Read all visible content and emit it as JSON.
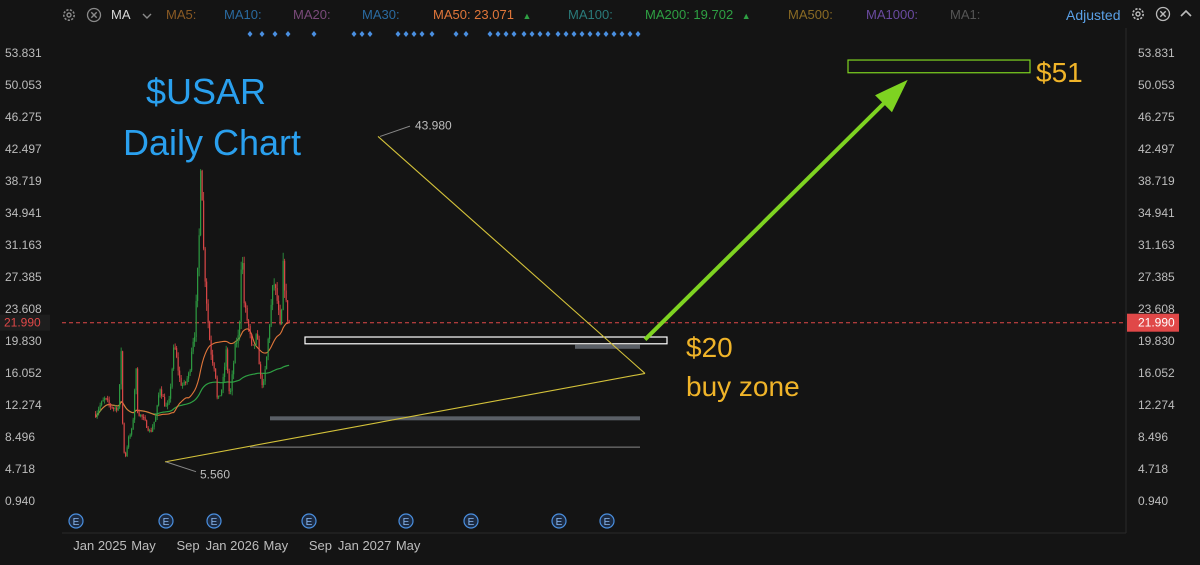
{
  "toolbar": {
    "indicator_select": "MA",
    "adjusted_label": "Adjusted",
    "ma_items": [
      {
        "label": "MA5:",
        "value": "",
        "color": "#8a5a24"
      },
      {
        "label": "MA10:",
        "value": "",
        "color": "#2a6aa0"
      },
      {
        "label": "MA20:",
        "value": "",
        "color": "#7a4a7a"
      },
      {
        "label": "MA30:",
        "value": "",
        "color": "#2a6aa0"
      },
      {
        "label": "MA50:",
        "value": "23.071",
        "color": "#e0763a",
        "arrow": "▲"
      },
      {
        "label": "MA100:",
        "value": "",
        "color": "#2a7a7a"
      },
      {
        "label": "MA200:",
        "value": "19.702",
        "color": "#2ea043",
        "arrow": "▲"
      },
      {
        "label": "MA500:",
        "value": "",
        "color": "#8a6a24"
      },
      {
        "label": "MA1000:",
        "value": "",
        "color": "#6a4aa0"
      },
      {
        "label": "MA1:",
        "value": "",
        "color": "#555555"
      }
    ]
  },
  "colors": {
    "up": "#2ea043",
    "down": "#e04848",
    "ma50": "#e0763a",
    "ma200": "#2ea043",
    "trendline": "#d4c23a",
    "annotation_blue": "#2aa0ee",
    "annotation_yellow": "#f0b429",
    "arrow_green": "#7ed321",
    "last_price": "#e04848"
  },
  "chart_data": {
    "type": "candlestick",
    "title": "$USAR",
    "subtitle": "Daily Chart",
    "y_ticks": [
      "53.831",
      "50.053",
      "46.275",
      "42.497",
      "38.719",
      "34.941",
      "31.163",
      "27.385",
      "23.608",
      "19.830",
      "16.052",
      "12.274",
      "8.496",
      "4.718",
      "0.940"
    ],
    "ylim": [
      0.94,
      53.831
    ],
    "x_ticks": [
      "Jan 2025",
      "May",
      "Sep",
      "Jan 2026",
      "May",
      "Sep",
      "Jan 2027",
      "May"
    ],
    "last_price": "21.990",
    "price_path": [
      [
        "2024-12-20",
        11.2
      ],
      [
        "2025-01-01",
        12.2
      ],
      [
        "2025-01-15",
        13.0
      ],
      [
        "2025-01-28",
        12.2
      ],
      [
        "2025-02-10",
        11.9
      ],
      [
        "2025-02-22",
        12.0
      ],
      [
        "2025-03-01",
        19.5
      ],
      [
        "2025-03-04",
        10.5
      ],
      [
        "2025-03-10",
        5.6
      ],
      [
        "2025-03-20",
        8.2
      ],
      [
        "2025-04-01",
        9.5
      ],
      [
        "2025-04-10",
        17.0
      ],
      [
        "2025-04-15",
        11.5
      ],
      [
        "2025-05-01",
        10.6
      ],
      [
        "2025-05-20",
        9.0
      ],
      [
        "2025-06-05",
        11.0
      ],
      [
        "2025-06-15",
        14.5
      ],
      [
        "2025-07-01",
        12.0
      ],
      [
        "2025-07-10",
        12.3
      ],
      [
        "2025-07-25",
        19.5
      ],
      [
        "2025-08-10",
        15.0
      ],
      [
        "2025-08-20",
        14.5
      ],
      [
        "2025-09-05",
        16.0
      ],
      [
        "2025-09-12",
        19.5
      ],
      [
        "2025-09-20",
        21.0
      ],
      [
        "2025-10-01",
        31.0
      ],
      [
        "2025-10-07",
        43.98
      ],
      [
        "2025-10-12",
        32.0
      ],
      [
        "2025-10-20",
        26.0
      ],
      [
        "2025-10-28",
        21.0
      ],
      [
        "2025-11-05",
        18.0
      ],
      [
        "2025-11-15",
        16.5
      ],
      [
        "2025-11-21",
        12.5
      ],
      [
        "2025-12-05",
        14.5
      ],
      [
        "2025-12-15",
        18.5
      ],
      [
        "2025-12-20",
        16.0
      ],
      [
        "2025-12-25",
        12.8
      ],
      [
        "2026-01-10",
        19.5
      ],
      [
        "2026-01-20",
        20.5
      ],
      [
        "2026-01-27",
        31.5
      ],
      [
        "2026-02-03",
        24.0
      ],
      [
        "2026-02-15",
        21.5
      ],
      [
        "2026-02-25",
        18.5
      ],
      [
        "2026-03-10",
        20.5
      ],
      [
        "2026-03-20",
        15.5
      ],
      [
        "2026-03-28",
        14.5
      ],
      [
        "2026-04-05",
        17.5
      ],
      [
        "2026-04-15",
        22.5
      ],
      [
        "2026-04-25",
        27.0
      ],
      [
        "2026-05-05",
        24.5
      ],
      [
        "2026-05-15",
        20.5
      ],
      [
        "2026-05-22",
        29.5
      ],
      [
        "2026-05-27",
        25.0
      ],
      [
        "2026-06-03",
        22.5
      ],
      [
        "2026-06-08",
        21.99
      ]
    ],
    "ma50_value": 23.071,
    "ma200_value": 19.702,
    "annotations": [
      {
        "text": "43.980",
        "kind": "high_label"
      },
      {
        "text": "5.560",
        "kind": "low_label"
      },
      {
        "text": "$20",
        "kind": "level"
      },
      {
        "text": "buy zone",
        "kind": "level"
      },
      {
        "text": "$51",
        "kind": "target"
      }
    ],
    "levels": {
      "buy_zone_low": 19.5,
      "buy_zone_high": 20.3,
      "target_low": 51.5,
      "target_high": 53.0,
      "support_1": 10.7,
      "support_2": 7.3
    },
    "grid": false,
    "event_markers": 9
  }
}
